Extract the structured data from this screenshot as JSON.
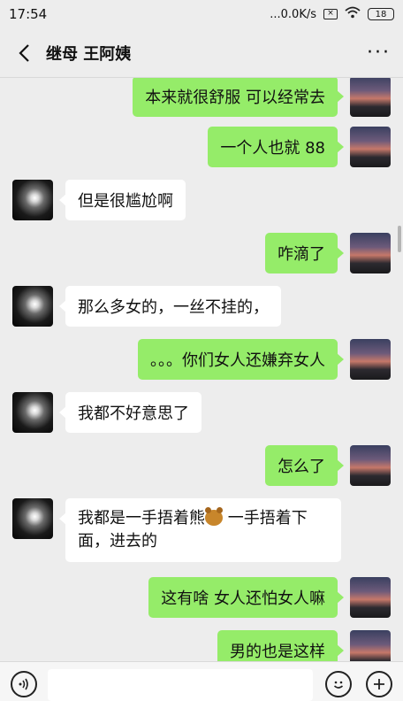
{
  "status": {
    "time": "17:54",
    "speed": "...0.0K/s",
    "battery": "18"
  },
  "header": {
    "title": "继母 王阿姨"
  },
  "messages": [
    {
      "from": "self",
      "text": "本来就很舒服  可以经常去"
    },
    {
      "from": "self",
      "text": "一个人也就 88"
    },
    {
      "from": "other",
      "text": "但是很尴尬啊"
    },
    {
      "from": "self",
      "text": "咋滴了"
    },
    {
      "from": "other",
      "text": "那么多女的，一丝不挂的，"
    },
    {
      "from": "self",
      "text": "。。。你们女人还嫌弃女人"
    },
    {
      "from": "other",
      "text": "我都不好意思了"
    },
    {
      "from": "self",
      "text": "怎么了"
    },
    {
      "from": "other",
      "text_a": "我都是一手捂着熊",
      "emoji": "bear-emoji",
      "text_b": " 一手捂着下面，进去的"
    },
    {
      "from": "self",
      "text": "这有啥  女人还怕女人嘛"
    },
    {
      "from": "self",
      "text": "男的也是这样"
    }
  ]
}
